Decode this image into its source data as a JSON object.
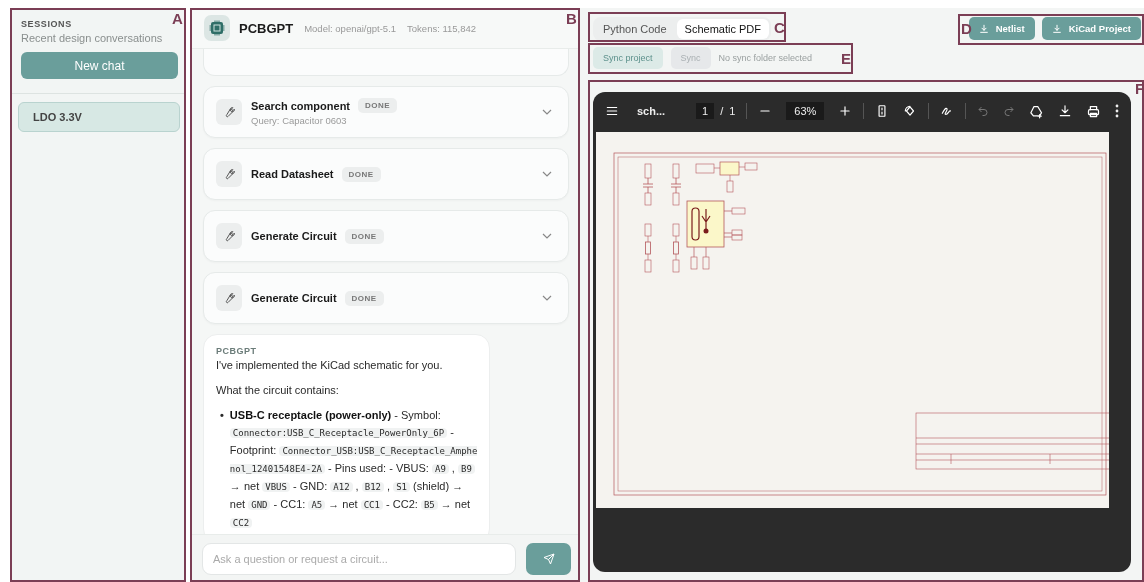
{
  "sidebar": {
    "heading": "SESSIONS",
    "subheading": "Recent design conversations",
    "new_chat_button": "New chat",
    "sessions": [
      {
        "title": "LDO 3.3V",
        "selected": true
      }
    ]
  },
  "chat": {
    "app_name": "PCBGPT",
    "model": "Model: openai/gpt-5.1",
    "tokens": "Tokens: 115,842",
    "tool_calls": [
      {
        "name": "Search component",
        "status": "DONE",
        "detail": "Query: Capacitor 0603"
      },
      {
        "name": "Read Datasheet",
        "status": "DONE"
      },
      {
        "name": "Generate Circuit",
        "status": "DONE"
      },
      {
        "name": "Generate Circuit",
        "status": "DONE"
      }
    ],
    "message": {
      "sender": "PCBGPT",
      "paragraphs": [
        "I've implemented the KiCad schematic for you.",
        "What the circuit contains:"
      ],
      "bullets": [
        {
          "marker": "•",
          "segments": [
            {
              "kind": "bold",
              "text": "USB-C receptacle (power-only)"
            },
            {
              "kind": "text",
              "text": " - Symbol: "
            },
            {
              "kind": "code",
              "text": "Connector:USB_C_Receptacle_PowerOnly_6P"
            },
            {
              "kind": "text",
              "text": " - Footprint: "
            },
            {
              "kind": "code",
              "text": "Connector_USB:USB_C_Receptacle_Amphenol_12401548E4-2A"
            },
            {
              "kind": "text",
              "text": " - Pins used: - VBUS: "
            },
            {
              "kind": "code",
              "text": "A9"
            },
            {
              "kind": "text",
              "text": " , "
            },
            {
              "kind": "code",
              "text": "B9"
            },
            {
              "kind": "text",
              "text": " → net "
            },
            {
              "kind": "code",
              "text": "VBUS"
            },
            {
              "kind": "text",
              "text": " - GND: "
            },
            {
              "kind": "code",
              "text": "A12"
            },
            {
              "kind": "text",
              "text": " , "
            },
            {
              "kind": "code",
              "text": "B12"
            },
            {
              "kind": "text",
              "text": " , "
            },
            {
              "kind": "code",
              "text": "S1"
            },
            {
              "kind": "text",
              "text": " (shield) → net "
            },
            {
              "kind": "code",
              "text": "GND"
            },
            {
              "kind": "text",
              "text": " - CC1: "
            },
            {
              "kind": "code",
              "text": "A5"
            },
            {
              "kind": "text",
              "text": " → net "
            },
            {
              "kind": "code",
              "text": "CC1"
            },
            {
              "kind": "text",
              "text": " - CC2: "
            },
            {
              "kind": "code",
              "text": "B5"
            },
            {
              "kind": "text",
              "text": " → net "
            },
            {
              "kind": "code",
              "text": "CC2"
            }
          ]
        }
      ]
    },
    "input": {
      "placeholder": "Ask a question or request a circuit..."
    }
  },
  "preview": {
    "tabs": [
      {
        "label": "Python Code",
        "selected": false
      },
      {
        "label": "Schematic PDF",
        "selected": true
      }
    ],
    "actions": [
      {
        "label": "Netlist"
      },
      {
        "label": "KiCad Project"
      }
    ],
    "sync": {
      "sync_project_button": "Sync project",
      "sync_button": {
        "label": "Sync",
        "disabled": true
      },
      "status": "No sync folder selected"
    },
    "pdf_viewer": {
      "file_name": "sch...",
      "page": "1",
      "page_separator": "/",
      "page_count": "1",
      "zoom": "63%"
    }
  },
  "annotations": [
    {
      "label": "A"
    },
    {
      "label": "B"
    },
    {
      "label": "C"
    },
    {
      "label": "D"
    },
    {
      "label": "E"
    },
    {
      "label": "F"
    }
  ]
}
